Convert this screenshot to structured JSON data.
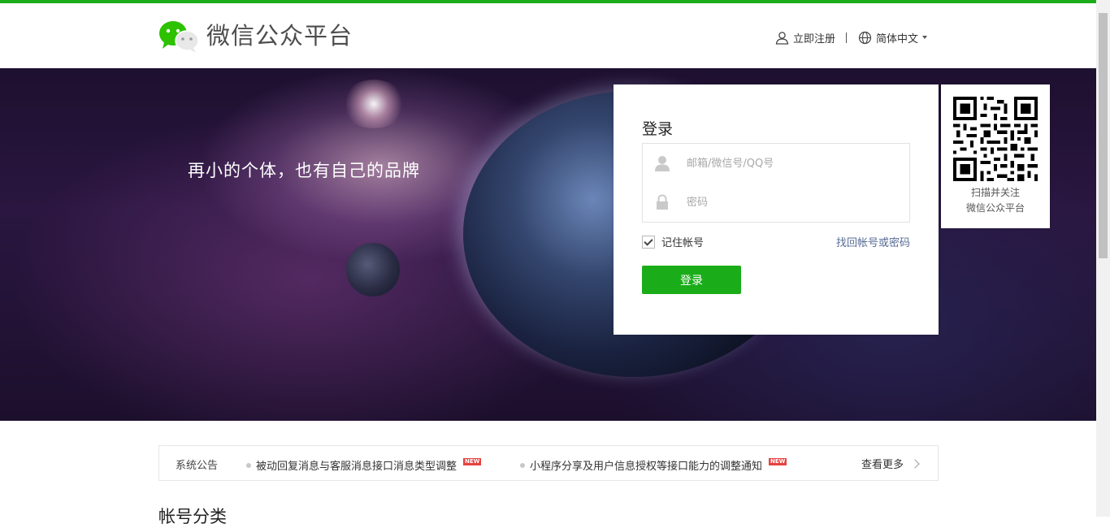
{
  "header": {
    "brand": "微信公众平台",
    "register_label": "立即注册",
    "language_label": "简体中文",
    "icons": {
      "logo": "wechat-logo",
      "register": "user-icon",
      "language": "globe-icon"
    }
  },
  "hero": {
    "slogan": "再小的个体，也有自己的品牌"
  },
  "login": {
    "title": "登录",
    "account_placeholder": "邮箱/微信号/QQ号",
    "password_placeholder": "密码",
    "remember_label": "记住帐号",
    "remember_checked": true,
    "forgot_label": "找回帐号或密码",
    "submit_label": "登录"
  },
  "qr": {
    "caption_line1": "扫描并关注",
    "caption_line2": "微信公众平台"
  },
  "notices": {
    "label": "系统公告",
    "items": [
      {
        "text": "被动回复消息与客服消息接口消息类型调整",
        "badge": "NEW"
      },
      {
        "text": "小程序分享及用户信息授权等接口能力的调整通知",
        "badge": "NEW"
      }
    ],
    "more_label": "查看更多"
  },
  "section": {
    "title": "帐号分类"
  },
  "colors": {
    "accent": "#1aad19",
    "link": "#576b95",
    "badge": "#e64340"
  }
}
